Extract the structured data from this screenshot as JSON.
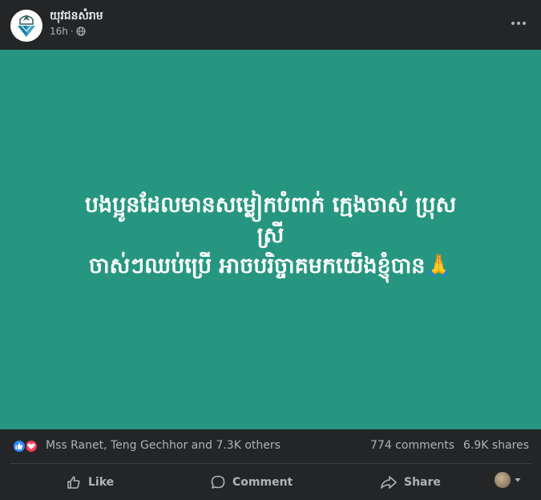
{
  "post": {
    "page_name": "យុវជនសំរាម",
    "time": "16h",
    "privacy_sep": "·",
    "privacy_icon": "globe-icon"
  },
  "image": {
    "background_color": "#279680",
    "text_line_1": "បងប្អូនដែលមានសម្លៀកបំពាក់ ក្មេងចាស់ ប្រុស",
    "text_line_2": "ស្រី",
    "text_line_3": "ចាស់ៗឈប់ប្រើ អាចបរិច្ចាគមកយើងខ្ញុំបាន🙏"
  },
  "reactions": {
    "icons": [
      "like-reaction-icon",
      "love-reaction-icon"
    ],
    "names": "Mss Ranet, Teng Gechhor and 7.3K others",
    "comments": "774 comments",
    "shares": "6.9K shares"
  },
  "actions": {
    "like": "Like",
    "comment": "Comment",
    "share": "Share"
  },
  "colors": {
    "background": "#242526",
    "secondary_text": "#b0b3b8",
    "like_blue": "#2e89ff",
    "love_red": "#f33e58"
  }
}
